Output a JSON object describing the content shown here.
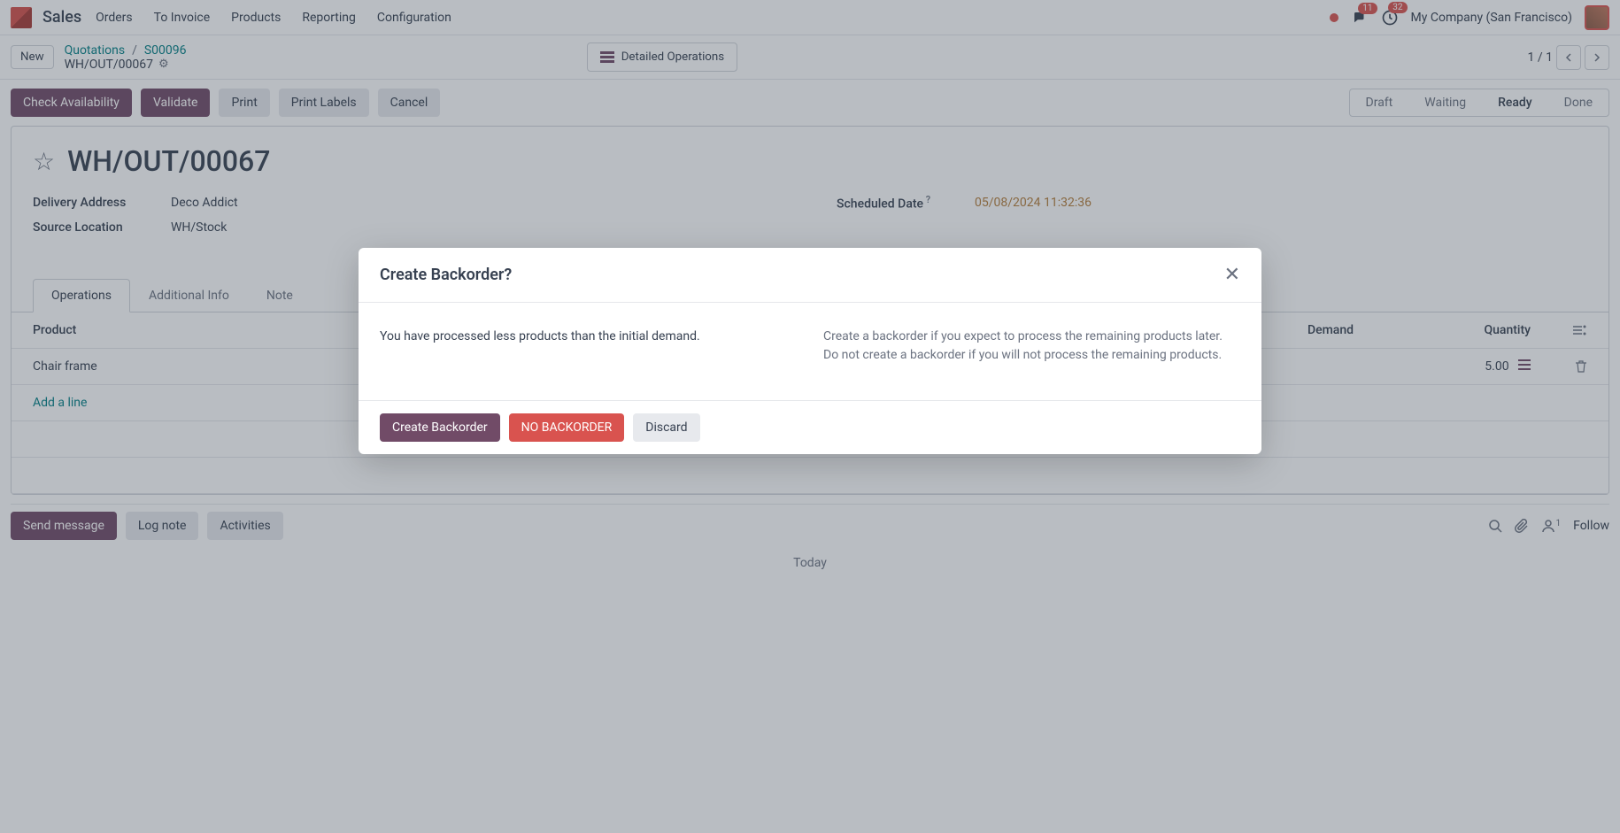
{
  "navbar": {
    "app": "Sales",
    "menu": [
      "Orders",
      "To Invoice",
      "Products",
      "Reporting",
      "Configuration"
    ],
    "messages_badge": "11",
    "activities_badge": "32",
    "company": "My Company (San Francisco)"
  },
  "breadcrumb": {
    "new_label": "New",
    "items": [
      "Quotations",
      "S00096"
    ],
    "current": "WH/OUT/00067",
    "detailed_ops": "Detailed Operations",
    "pager": "1 / 1"
  },
  "actions": {
    "check_availability": "Check Availability",
    "validate": "Validate",
    "print": "Print",
    "print_labels": "Print Labels",
    "cancel": "Cancel"
  },
  "statusbar": [
    "Draft",
    "Waiting",
    "Ready",
    "Done"
  ],
  "record": {
    "title": "WH/OUT/00067",
    "fields": {
      "delivery_address_label": "Delivery Address",
      "delivery_address_value": "Deco Addict",
      "scheduled_date_label": "Scheduled Date",
      "scheduled_date_value": "05/08/2024 11:32:36",
      "source_location_label": "Source Location",
      "source_location_value": "WH/Stock"
    }
  },
  "tabs": {
    "operations": "Operations",
    "additional": "Additional Info",
    "note": "Note"
  },
  "table": {
    "headers": {
      "product": "Product",
      "demand": "Demand",
      "quantity": "Quantity"
    },
    "row": {
      "product": "Chair frame",
      "quantity": "5.00"
    },
    "add_line": "Add a line"
  },
  "chatter": {
    "send_message": "Send message",
    "log_note": "Log note",
    "activities": "Activities",
    "follow": "Follow",
    "follower_count": "1",
    "today": "Today"
  },
  "modal": {
    "title": "Create Backorder?",
    "text_left": "You have processed less products than the initial demand.",
    "text_right": "Create a backorder if you expect to process the remaining products later. Do not create a backorder if you will not process the remaining products.",
    "create": "Create Backorder",
    "no_backorder": "NO BACKORDER",
    "discard": "Discard"
  }
}
